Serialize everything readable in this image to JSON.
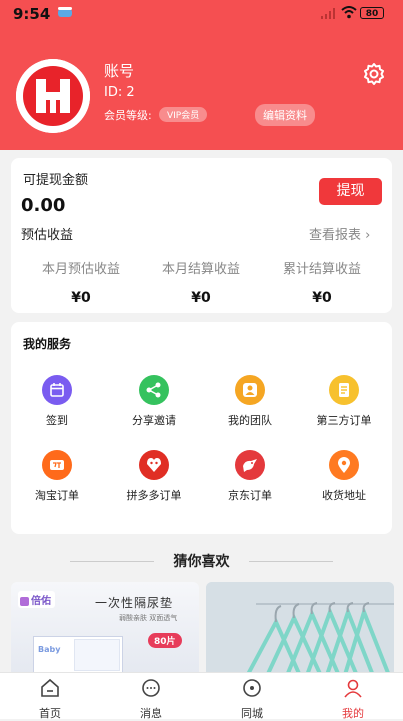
{
  "status": {
    "time": "9:54",
    "battery": "80"
  },
  "profile": {
    "name": "账号",
    "id": "ID: 2",
    "level_label": "会员等级:",
    "level": "VIP会员",
    "edit": "编辑资料"
  },
  "wallet": {
    "withdrawable_label": "可提现金额",
    "withdrawable": "0.00",
    "withdraw_button": "提现",
    "estimated_label": "预估收益",
    "report_link": "查看报表 ›",
    "stats": [
      {
        "label": "本月预估收益",
        "value": "¥0"
      },
      {
        "label": "本月结算收益",
        "value": "¥0"
      },
      {
        "label": "累计结算收益",
        "value": "¥0"
      }
    ]
  },
  "services": {
    "title": "我的服务",
    "items": [
      {
        "label": "签到",
        "icon": "calendar-icon",
        "color": "#7a5cf0"
      },
      {
        "label": "分享邀请",
        "icon": "share-icon",
        "color": "#35c25e"
      },
      {
        "label": "我的团队",
        "icon": "team-icon",
        "color": "#f5a623"
      },
      {
        "label": "第三方订单",
        "icon": "order-icon",
        "color": "#f7c12e"
      },
      {
        "label": "淘宝订单",
        "icon": "taobao-icon",
        "color": "#ff6a1a"
      },
      {
        "label": "拼多多订单",
        "icon": "pinduoduo-icon",
        "color": "#e02e24"
      },
      {
        "label": "京东订单",
        "icon": "jd-icon",
        "color": "#e4393c"
      },
      {
        "label": "收货地址",
        "icon": "location-icon",
        "color": "#ff7a21"
      }
    ]
  },
  "recommend": {
    "title": "猜你喜欢",
    "products": [
      {
        "brand": "倍佑",
        "headline": "一次性隔尿垫",
        "sub": "弱酸亲肤 双面透气",
        "badge": "80片",
        "pack": "Baby"
      },
      {
        "name": "衣架"
      }
    ]
  },
  "tabs": [
    {
      "label": "首页",
      "icon": "home-icon"
    },
    {
      "label": "消息",
      "icon": "message-icon"
    },
    {
      "label": "同城",
      "icon": "nearby-icon"
    },
    {
      "label": "我的",
      "icon": "profile-icon",
      "active": true
    }
  ],
  "colors": {
    "brand": "#f54f51",
    "active_tab": "#e4393c"
  }
}
